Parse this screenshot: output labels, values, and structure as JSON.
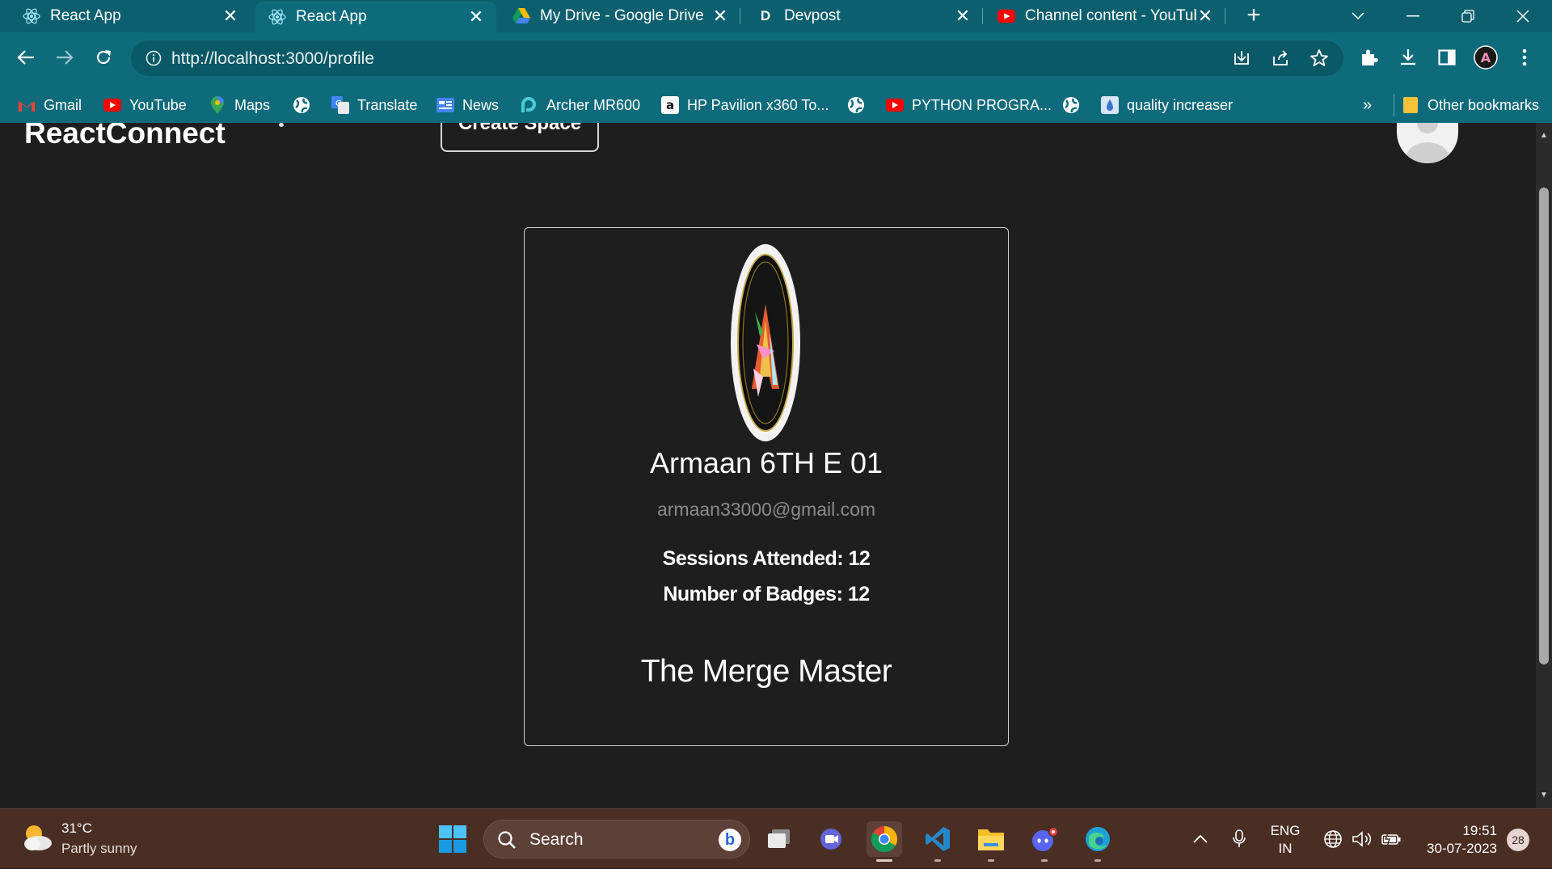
{
  "browser": {
    "tabs": [
      {
        "title": "React App",
        "icon": "react-icon",
        "active": false
      },
      {
        "title": "React App",
        "icon": "react-icon",
        "active": true
      },
      {
        "title": "My Drive - Google Drive",
        "icon": "google-drive-icon",
        "active": false
      },
      {
        "title": "Devpost",
        "icon": "devpost-icon",
        "active": false
      },
      {
        "title": "Channel content - YouTub",
        "icon": "youtube-icon",
        "active": false
      }
    ],
    "url_host": "http://localhost",
    "url_rest": ":3000/profile",
    "bookmarks": [
      {
        "label": "Gmail",
        "icon": "gmail-icon"
      },
      {
        "label": "YouTube",
        "icon": "youtube-icon"
      },
      {
        "label": "Maps",
        "icon": "maps-icon"
      },
      {
        "label": "",
        "icon": "globe-icon"
      },
      {
        "label": "Translate",
        "icon": "translate-icon"
      },
      {
        "label": "News",
        "icon": "news-icon"
      },
      {
        "label": "Archer MR600",
        "icon": "tplink-icon"
      },
      {
        "label": "HP Pavilion x360 To...",
        "icon": "amazon-icon"
      },
      {
        "label": "",
        "icon": "globe-icon"
      },
      {
        "label": "PYTHON PROGRA...",
        "icon": "youtube-icon"
      },
      {
        "label": "",
        "icon": "globe-icon"
      },
      {
        "label": "quality increaser",
        "icon": "image-icon"
      }
    ],
    "bookmarks_overflow": "»",
    "other_bookmarks": "Other bookmarks",
    "accent_color": "#0e6b7b"
  },
  "app": {
    "brand": "ReactConnect",
    "create_button": "Create Space",
    "profile": {
      "name": "Armaan 6TH E 01",
      "email": "armaan33000@gmail.com",
      "sessions_label": "Sessions Attended: 12",
      "badges_label": "Number of Badges: 12",
      "title": "The Merge Master"
    }
  },
  "taskbar": {
    "weather_temp": "31°C",
    "weather_desc": "Partly sunny",
    "search_placeholder": "Search",
    "lang_line1": "ENG",
    "lang_line2": "IN",
    "time": "19:51",
    "date": "30-07-2023",
    "notification_count": "28"
  }
}
